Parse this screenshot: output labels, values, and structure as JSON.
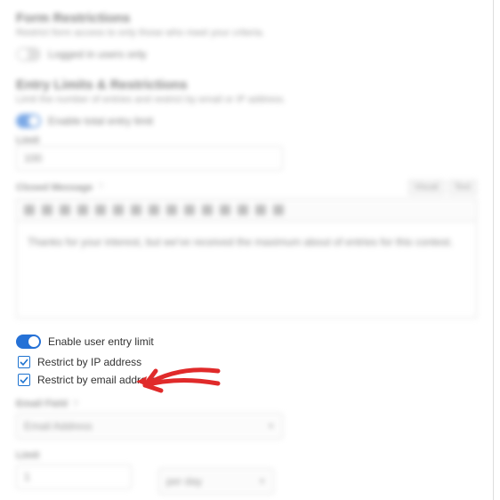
{
  "formRestrictions": {
    "title": "Form Restrictions",
    "desc": "Restrict form access to only those who meet your criteria.",
    "loggedInToggleLabel": "Logged in users only"
  },
  "entryLimits": {
    "title": "Entry Limits & Restrictions",
    "desc": "Limit the number of entries and restrict by email or IP address.",
    "enableTotalLabel": "Enable total entry limit",
    "limitLabel": "Limit",
    "limitValue": "100",
    "closedMsgLabel": "Closed Message",
    "visualTab": "Visual",
    "textTab": "Text",
    "editorContent": "Thanks for your interest, but we've received the maximum about of entries for this contest."
  },
  "userEntry": {
    "enableLabel": "Enable user entry limit",
    "restrictIpLabel": "Restrict by IP address",
    "restrictEmailLabel": "Restrict by email address",
    "emailFieldLabel": "Email Field",
    "emailFieldValue": "Email Address",
    "limitLabel": "Limit",
    "limitNumValue": "1",
    "limitRuleValue": "per day"
  }
}
